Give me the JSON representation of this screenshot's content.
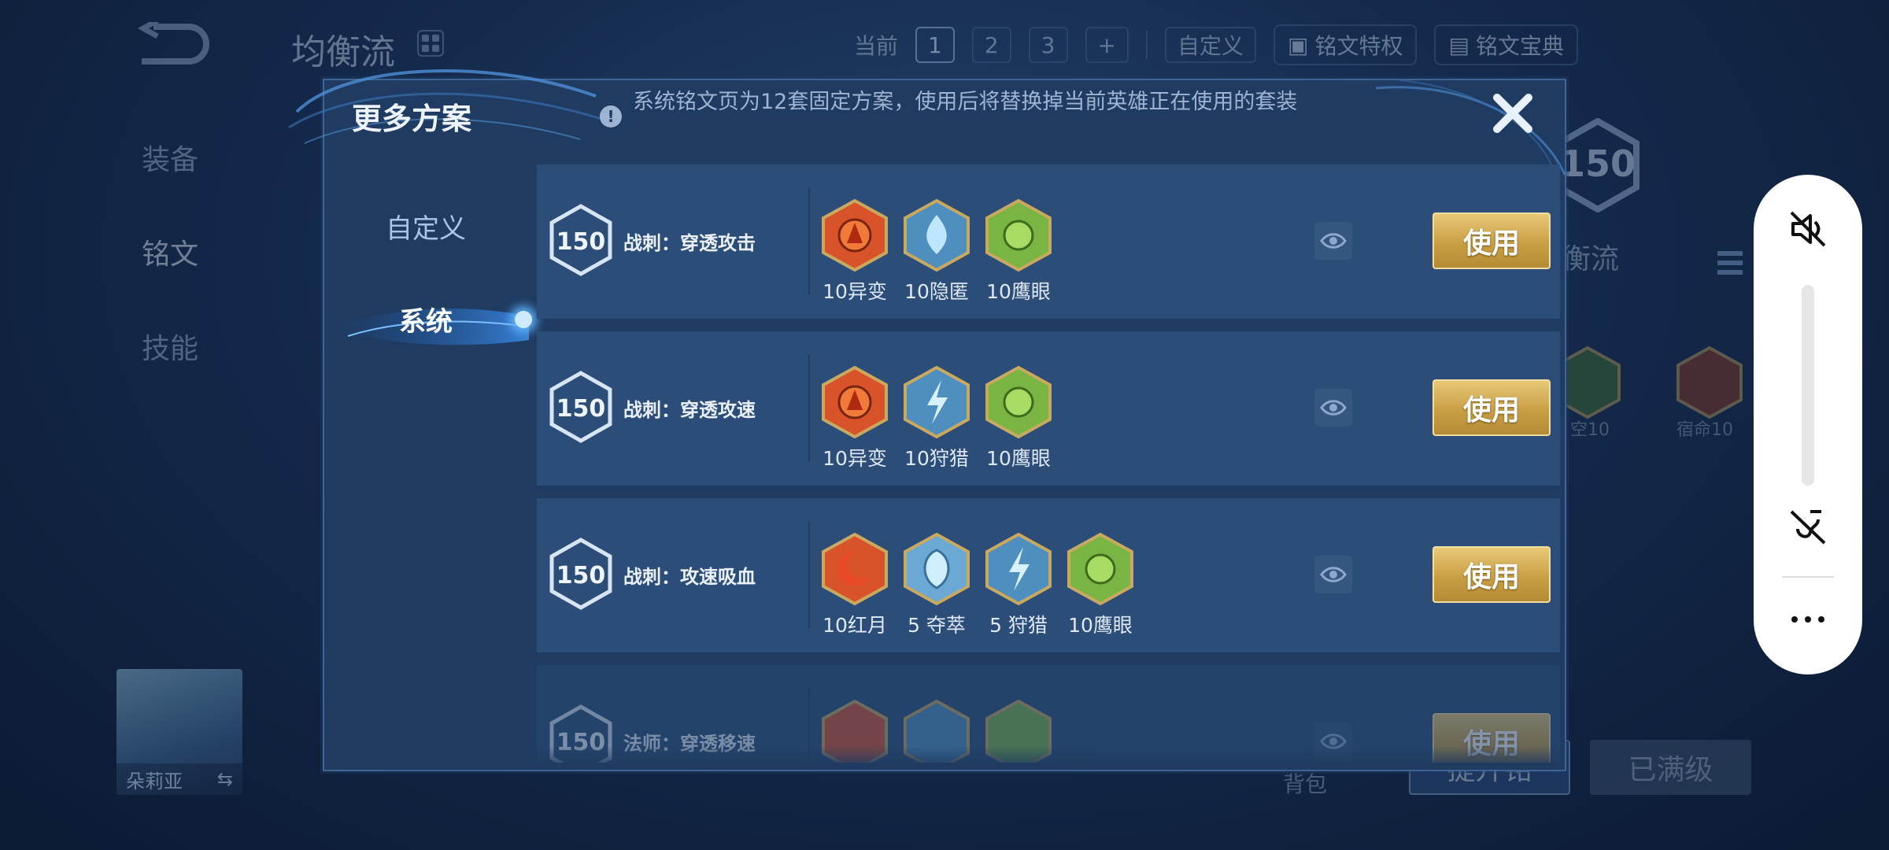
{
  "background": {
    "page_title": "均衡流",
    "topbar": {
      "current_label": "当前",
      "pages": [
        "1",
        "2",
        "3"
      ],
      "add_label": "+",
      "custom_label": "自定义",
      "privilege_label": "铭文特权",
      "codex_label": "铭文宝典"
    },
    "side_nav": [
      "装备",
      "铭文",
      "技能"
    ],
    "hero_name": "朵莉亚",
    "big_level": "150",
    "right_label": "衡流",
    "rune_labels": [
      "空10",
      "宿命10"
    ],
    "bag_label": "背包",
    "btn_upgrade": "提升铭",
    "btn_max": "已满级"
  },
  "modal": {
    "title": "更多方案",
    "info_text": "系统铭文页为12套固定方案，使用后将替换掉当前英雄正在使用的套装",
    "tabs": {
      "custom": "自定义",
      "system": "系统"
    },
    "use_label": "使用",
    "rows": [
      {
        "level": "150",
        "name": "战刺：穿透攻击",
        "runes": [
          {
            "label": "10异变",
            "icon": "red-rune-icon"
          },
          {
            "label": "10隐匿",
            "icon": "blue-rune-icon"
          },
          {
            "label": "10鹰眼",
            "icon": "green-rune-icon"
          }
        ]
      },
      {
        "level": "150",
        "name": "战刺：穿透攻速",
        "runes": [
          {
            "label": "10异变",
            "icon": "red-rune-icon"
          },
          {
            "label": "10狩猎",
            "icon": "blue-rune-icon"
          },
          {
            "label": "10鹰眼",
            "icon": "green-rune-icon"
          }
        ]
      },
      {
        "level": "150",
        "name": "战刺：攻速吸血",
        "runes": [
          {
            "label": "10红月",
            "icon": "red-rune-icon"
          },
          {
            "label": "5 夺萃",
            "icon": "blue-rune-icon"
          },
          {
            "label": "5 狩猎",
            "icon": "blue-rune-icon"
          },
          {
            "label": "10鹰眼",
            "icon": "green-rune-icon"
          }
        ]
      },
      {
        "level": "150",
        "name": "法师：穿透移速",
        "runes": [
          {
            "label": "",
            "icon": "red-rune-icon"
          },
          {
            "label": "",
            "icon": "blue-rune-icon"
          },
          {
            "label": "",
            "icon": "green-rune-icon"
          }
        ]
      }
    ]
  },
  "colors": {
    "red_rune": "#d9532a",
    "blue_rune": "#7fc4e6",
    "green_rune": "#7ab544",
    "gold_button": "#d4ad57"
  }
}
